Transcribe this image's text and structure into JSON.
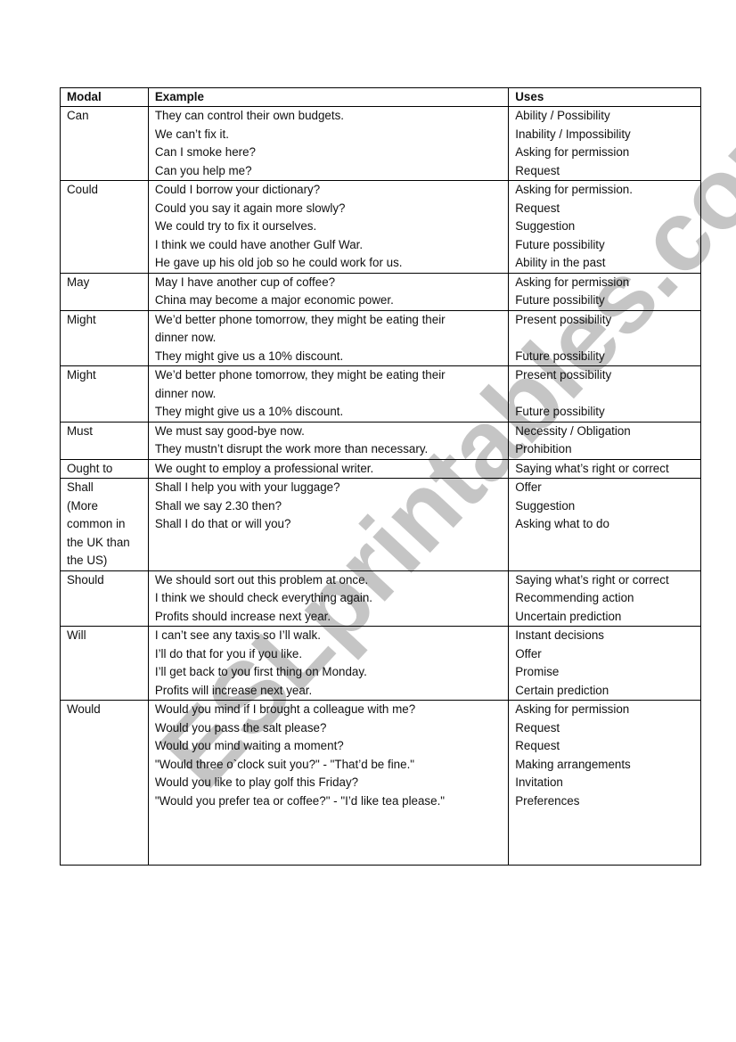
{
  "watermark": "ESLprintables.com",
  "table": {
    "headers": [
      "Modal",
      "Example",
      "Uses"
    ],
    "rows": [
      {
        "modal": [
          "Can"
        ],
        "examples": [
          "They can control their own budgets.",
          "We can’t fix it.",
          "Can I smoke here?",
          "Can you help me?"
        ],
        "uses": [
          "Ability / Possibility",
          "Inability / Impossibility",
          "Asking for permission",
          "Request"
        ]
      },
      {
        "modal": [
          "Could"
        ],
        "examples": [
          "Could I borrow your dictionary?",
          "Could you say it again more slowly?",
          "We could try to fix it ourselves.",
          "I think we could have another Gulf War.",
          "He gave up his old job so he could work for us."
        ],
        "uses": [
          "Asking for permission.",
          "Request",
          "Suggestion",
          "Future possibility",
          "Ability in the past"
        ]
      },
      {
        "modal": [
          "May"
        ],
        "examples": [
          "May I have another cup of coffee?",
          "China may become a major economic power."
        ],
        "uses": [
          "Asking for permission",
          "Future possibility"
        ]
      },
      {
        "modal": [
          "Might"
        ],
        "examples": [
          "We’d better phone tomorrow, they might be eating their",
          "dinner now.",
          "They might give us a 10% discount."
        ],
        "uses": [
          "Present possibility",
          "",
          "Future possibility"
        ]
      },
      {
        "modal": [
          "Might"
        ],
        "examples": [
          "We’d better phone tomorrow, they might be eating their",
          "dinner now.",
          "They might give us a 10% discount."
        ],
        "uses": [
          "Present possibility",
          "",
          "Future possibility"
        ]
      },
      {
        "modal": [
          "Must"
        ],
        "examples": [
          "We must say good-bye now.",
          "They mustn’t disrupt the work more than necessary."
        ],
        "uses": [
          "Necessity / Obligation",
          "Prohibition"
        ]
      },
      {
        "modal": [
          "Ought to"
        ],
        "examples": [
          "We ought to employ a professional writer."
        ],
        "uses": [
          "Saying what’s right or correct"
        ]
      },
      {
        "modal": [
          "Shall",
          "(More",
          "common in",
          "the UK than",
          "the US)"
        ],
        "examples": [
          "Shall I help you with your luggage?",
          "Shall we say 2.30 then?",
          "Shall I do that or will you?"
        ],
        "uses": [
          "Offer",
          "Suggestion",
          "Asking what to do"
        ]
      },
      {
        "modal": [
          "Should"
        ],
        "examples": [
          "We should sort out this problem at once.",
          "I think we should check everything again.",
          "Profits should increase next year."
        ],
        "uses": [
          "Saying what’s right or correct",
          "Recommending action",
          "Uncertain prediction"
        ]
      },
      {
        "modal": [
          "Will"
        ],
        "examples": [
          "I can’t see any taxis so I’ll walk.",
          "I’ll do that for you if you like.",
          "I’ll get back to you first thing on Monday.",
          "Profits will increase next year."
        ],
        "uses": [
          "Instant decisions",
          "Offer",
          "Promise",
          "Certain prediction"
        ]
      },
      {
        "modal": [
          "Would"
        ],
        "examples": [
          "Would you mind if I brought a colleague with me?",
          "Would you pass the salt please?",
          "Would you mind waiting a moment?",
          "\"Would three o`clock suit you?\" - \"That’d be fine.\"",
          "Would you like to play golf this Friday?",
          "\"Would you prefer tea or coffee?\" - \"I’d like tea please.\""
        ],
        "uses": [
          "Asking for permission",
          "Request",
          "Request",
          "Making arrangements",
          "Invitation",
          "Preferences"
        ]
      }
    ]
  }
}
